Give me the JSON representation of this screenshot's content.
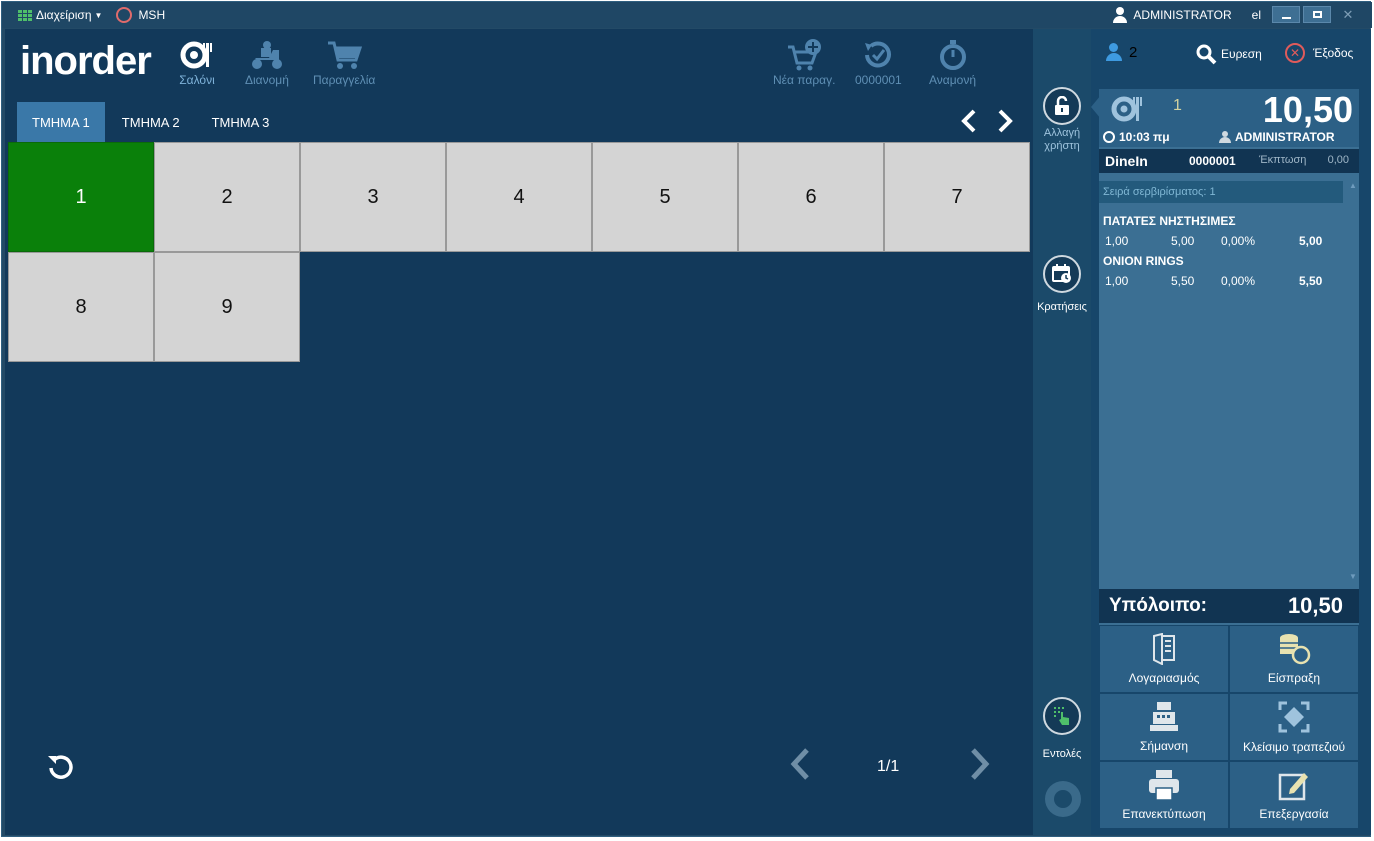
{
  "titlebar": {
    "menu_label": "Διαχείριση",
    "station_label": "MSH",
    "user": "ADMINISTRATOR",
    "language": "el"
  },
  "header": {
    "logo": "inorder",
    "nav": [
      {
        "label": "Σαλόνι",
        "icon": "dining-icon"
      },
      {
        "label": "Διανομή",
        "icon": "scooter-icon"
      },
      {
        "label": "Παραγγελία",
        "icon": "cart-icon"
      }
    ],
    "actions": [
      {
        "label": "Νέα παραγ.",
        "icon": "cart-plus-icon"
      },
      {
        "label": "0000001",
        "icon": "history-icon"
      },
      {
        "label": "Αναμονή",
        "icon": "stopwatch-icon"
      }
    ]
  },
  "tabs": [
    "ΤΜΗΜΑ 1",
    "ΤΜΗΜΑ 2",
    "ΤΜΗΜΑ 3"
  ],
  "tables": [
    {
      "number": "1",
      "status": "occupied"
    },
    {
      "number": "2",
      "status": "free"
    },
    {
      "number": "3",
      "status": "free"
    },
    {
      "number": "4",
      "status": "free"
    },
    {
      "number": "5",
      "status": "free"
    },
    {
      "number": "6",
      "status": "free"
    },
    {
      "number": "7",
      "status": "free"
    },
    {
      "number": "8",
      "status": "free"
    },
    {
      "number": "9",
      "status": "free"
    }
  ],
  "pager": {
    "label": "1/1"
  },
  "sidebar": {
    "change_user_label": "Αλλαγή χρήστη",
    "reservations_label": "Κρατήσεις",
    "commands_label": "Εντολές"
  },
  "order": {
    "guests": "2",
    "find_label": "Ευρεση",
    "exit_label": "Έξοδος",
    "table_number": "1",
    "total": "10,50",
    "time": "10:03 πμ",
    "waiter": "ADMINISTRATOR",
    "type": "DineIn",
    "order_no": "0000001",
    "discount_label": "Έκπτωση",
    "discount_value": "0,00",
    "serving_order": "Σειρά σερβιρίσματος: 1",
    "lines": [
      {
        "name": "ΠΑΤΑΤΕΣ ΝΗΣΤΗΣΙΜΕΣ",
        "qty": "1,00",
        "price": "5,00",
        "disc": "0,00%",
        "amount": "5,00"
      },
      {
        "name": "ONION RINGS",
        "qty": "1,00",
        "price": "5,50",
        "disc": "0,00%",
        "amount": "5,50"
      }
    ],
    "balance_label": "Υπόλοιπο:",
    "balance_value": "10,50"
  },
  "actions": [
    {
      "label": "Λογαριασμός",
      "icon": "bill-icon"
    },
    {
      "label": "Είσπραξη",
      "icon": "coins-icon"
    },
    {
      "label": "Σήμανση",
      "icon": "cash-register-icon"
    },
    {
      "label": "Κλείσιμο τραπεζιού",
      "icon": "close-table-icon"
    },
    {
      "label": "Επανεκτύπωση",
      "icon": "printer-icon"
    },
    {
      "label": "Επεξεργασία",
      "icon": "edit-icon"
    }
  ],
  "colors": {
    "background": "#12395a",
    "occupied": "#0a800a",
    "free": "#d4d4d4",
    "active_tab": "#3a78a8"
  }
}
